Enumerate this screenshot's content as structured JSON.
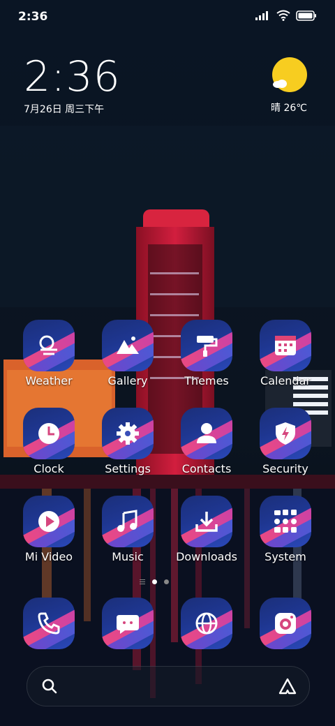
{
  "status_bar": {
    "time": "2:36",
    "icons": [
      "signal-icon",
      "wifi-icon",
      "battery-icon"
    ]
  },
  "clock_widget": {
    "time": "2:36",
    "date": "7月26日 周三下午"
  },
  "weather_widget": {
    "icon": "partly-sunny-icon",
    "text": "晴 26℃"
  },
  "apps": [
    {
      "label": "Weather",
      "icon": "weather-icon"
    },
    {
      "label": "Gallery",
      "icon": "gallery-icon"
    },
    {
      "label": "Themes",
      "icon": "themes-icon"
    },
    {
      "label": "Calendar",
      "icon": "calendar-icon"
    },
    {
      "label": "Clock",
      "icon": "clock-icon"
    },
    {
      "label": "Settings",
      "icon": "settings-icon"
    },
    {
      "label": "Contacts",
      "icon": "contacts-icon"
    },
    {
      "label": "Security",
      "icon": "security-icon"
    },
    {
      "label": "Mi Video",
      "icon": "video-icon"
    },
    {
      "label": "Music",
      "icon": "music-icon"
    },
    {
      "label": "Downloads",
      "icon": "downloads-icon"
    },
    {
      "label": "System",
      "icon": "system-folder-icon"
    }
  ],
  "dock": [
    {
      "icon": "phone-icon"
    },
    {
      "icon": "messages-icon"
    },
    {
      "icon": "browser-icon"
    },
    {
      "icon": "camera-icon"
    }
  ],
  "page_indicator": {
    "pages": 2,
    "current": 1
  },
  "search": {
    "left_icon": "search-icon",
    "right_icon": "assistant-icon"
  },
  "colors": {
    "icon_blue": "#1e3690",
    "icon_pink": "#f04b7c",
    "icon_purple": "#7a3fc9",
    "sun": "#f7cd20"
  }
}
